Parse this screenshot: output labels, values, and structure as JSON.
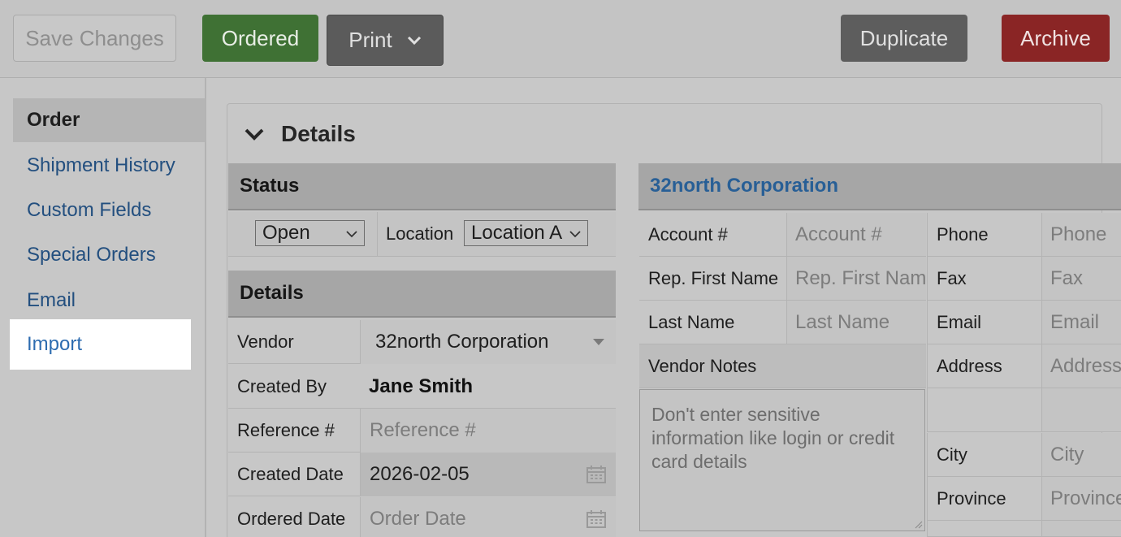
{
  "toolbar": {
    "save_label": "Save Changes",
    "ordered_label": "Ordered",
    "print_label": "Print",
    "duplicate_label": "Duplicate",
    "archive_label": "Archive"
  },
  "sidebar": {
    "items": [
      {
        "label": "Order"
      },
      {
        "label": "Shipment History"
      },
      {
        "label": "Custom Fields"
      },
      {
        "label": "Special Orders"
      },
      {
        "label": "Email"
      },
      {
        "label": "Import"
      }
    ]
  },
  "panel": {
    "title": "Details"
  },
  "status": {
    "heading": "Status",
    "status_value": "Open",
    "location_label": "Location",
    "location_value": "Location A"
  },
  "details": {
    "heading": "Details",
    "vendor_label": "Vendor",
    "vendor_value": "32north Corporation",
    "created_by_label": "Created By",
    "created_by_value": "Jane Smith",
    "reference_label": "Reference #",
    "reference_placeholder": "Reference #",
    "created_date_label": "Created Date",
    "created_date_value": "2026-02-05",
    "ordered_date_label": "Ordered Date",
    "ordered_date_placeholder": "Order Date"
  },
  "vendor_card": {
    "name": "32north Corporation",
    "account_label": "Account #",
    "account_placeholder": "Account #",
    "rep_first_label": "Rep. First Name",
    "rep_first_placeholder": "Rep. First Nam",
    "last_name_label": "Last Name",
    "last_name_placeholder": "Last Name",
    "notes_label": "Vendor Notes",
    "notes_placeholder": "Don't enter sensitive information like login or credit card details",
    "phone_label": "Phone",
    "phone_placeholder": "Phone",
    "fax_label": "Fax",
    "fax_placeholder": "Fax",
    "email_label": "Email",
    "email_placeholder": "Email",
    "address_label": "Address",
    "address_placeholder": "Address",
    "city_label": "City",
    "city_placeholder": "City",
    "province_label": "Province",
    "province_placeholder": "Province"
  },
  "colors": {
    "ordered": "#3f7134",
    "archive": "#8a2525",
    "link": "#234f7f",
    "vendor_name": "#285f96"
  },
  "icons": [
    "chevron-down-icon",
    "calendar-icon",
    "select-caret-icon",
    "resize-grip-icon"
  ]
}
